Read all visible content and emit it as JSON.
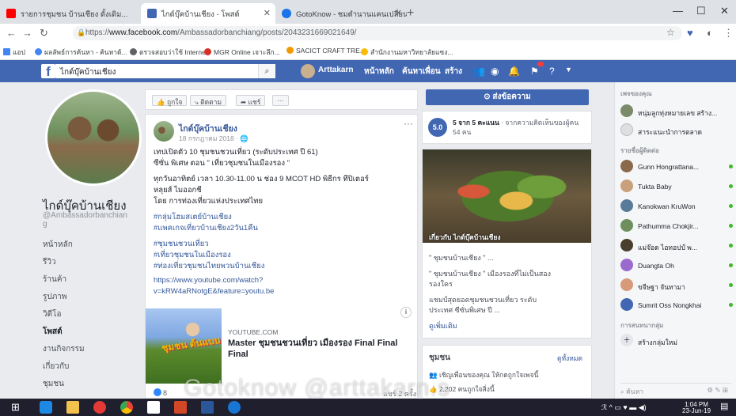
{
  "browser": {
    "tabs": [
      {
        "label": "รายการชุมชน บ้านเชียง ดั้งเดิม...",
        "icon": "youtube-icon",
        "color": "#ff0000"
      },
      {
        "label": "ไกด์บุ๊คบ้านเชียง - โพสต์",
        "icon": "facebook-icon",
        "color": "#4267b2"
      },
      {
        "label": "GotoKnow - ชมตำนานแคนเปลี่ยนไป...",
        "icon": "gotoknow-icon",
        "color": "#1a73e8"
      }
    ],
    "url_prefix": "https://",
    "url_host": "www.facebook.com",
    "url_path": "/Ambassadorbanchiang/posts/2043231669021649/",
    "bookmarks": [
      {
        "label": "แอป",
        "color": "#4285f4"
      },
      {
        "label": "ผลลัพธ์การค้นหา - ค้นหาด้...",
        "color": "#4285f4"
      },
      {
        "label": "ตรวจสอบว่าใช้ Internet",
        "color": "#5f6368"
      },
      {
        "label": "MGR Online เจาะลึก...",
        "color": "#d93025"
      },
      {
        "label": "SACICT CRAFT TRE...",
        "color": "#f29900"
      },
      {
        "label": "สำนักงานมหาวิทยาลัยแซง...",
        "color": "#fbbc04"
      }
    ]
  },
  "fb": {
    "search_value": "ไกด์บุ๊คบ้านเชียง",
    "user_name": "Arttakarn",
    "nav": [
      "หน้าหลัก",
      "ค้นหาเพื่อน",
      "สร้าง"
    ],
    "colors": {
      "brand": "#4267b2",
      "link": "#365899"
    }
  },
  "left": {
    "page_name": "ไกด์บุ๊คบ้านเชียง",
    "page_handle": "@Ambassadorbanchiang",
    "nav": [
      "หน้าหลัก",
      "รีวิว",
      "ร้านค้า",
      "รูปภาพ",
      "วิดีโอ",
      "โพสต์",
      "งานกิจกรรม",
      "เกี่ยวกับ",
      "ชุมชน"
    ],
    "selected_index": 5
  },
  "center": {
    "tab_buttons": [
      "ถูกใจ",
      "ติดตาม",
      "แชร์",
      "···"
    ],
    "post": {
      "author": "ไกด์บุ๊คบ้านเชียง",
      "date": "18 กรกฎาคม 2018 · ",
      "lines": [
        "เทปเปิดตัว 10 ชุมชนชวนเที่ยว (ระดับประเทศ ปี 61)",
        "ซีซั่น พิเศษ ตอน \" เที่ยวชุมชนในเมืองรอง \"",
        "ทุกวันอาทิตย์ เวลา 10.30-11.00 น ช่อง 9 MCOT HD พิธีกร ทีปิเตอร์",
        "หลุยส์ ไมออกชี",
        "โดย การท่องเที่ยวแห่งประเทศไทย"
      ],
      "tags_a": [
        "#กลุ่มโฮมสเตย์บ้านเชียง",
        "#แพคเกจเที่ยวบ้านเชียง2วัน1คืน"
      ],
      "tags_b": [
        "#ชุมชนชวนเที่ยว",
        "#เที่ยวชุมชนในเมืองรอง",
        "#ท่องเที่ยวชุมชนไทยพวนบ้านเชียง"
      ],
      "link_line1": "https://www.youtube.com/watch?",
      "link_line2": "v=kRW4aRNotgE&feature=youtu.be",
      "thumb_text": "ชุมชน ต้นแบบ",
      "link_domain": "YOUTUBE.COM",
      "link_title": "Master ชุมชนชวนเที่ยว เมืองรอง Final Final Final",
      "info_glyph": "i",
      "reactions_count": "8",
      "shares": "แชร์ 2 ครั้ง"
    }
  },
  "right": {
    "message_button": "ส่งข้อความ",
    "rating": {
      "score": "5.0",
      "headline": "5 จาก 5 คะแนน",
      "subtext": "จากความคิดเห็นของผู้คน 54 คน"
    },
    "video": {
      "caption": "เกี่ยวกับ ไกด์บุ๊คบ้านเชียง",
      "lines": [
        "\" ชุมชนบ้านเชียง \" ...",
        "\" ชุมชนบ้านเชียง \" เมืองรองที่ไม่เป็นสอง",
        "รองใคร",
        "แชมป์สุดยอดชุมชนชวนเที่ยว ระดับ",
        "ประเทศ ซีซั่นพิเศษ ปี ..."
      ],
      "see_more": "ดูเพิ่มเติม"
    },
    "community": {
      "title": "ชุมชน",
      "see_all": "ดูทั้งหมด",
      "lines": [
        "เชิญเพื่อนของคุณ ให้กดถูกใจเพจนี้",
        "2,202 คนถูกใจสิ่งนี้"
      ]
    }
  },
  "sidebar": {
    "pages_header": "เพจของคุณ",
    "pages": [
      {
        "label": "หนุ่มลูกทุ่งหมายเลข สร้าง...",
        "color": "#7a8a6a"
      },
      {
        "label": "สาระแนะนำการตลาด",
        "color": "#dddfe2"
      }
    ],
    "contacts_header": "รายชื่อผู้ติดต่อ",
    "contacts": [
      {
        "name": "Gunn Hongrattana...",
        "color": "#8a6a4a"
      },
      {
        "name": "Tukta Baby",
        "color": "#c9a07a"
      },
      {
        "name": "Kanokwan KruWon",
        "color": "#5a7a9a"
      },
      {
        "name": "Pathumma Chokjir...",
        "color": "#6e8f5d"
      },
      {
        "name": "แม่จ๊อด ไอทอปป์ พ...",
        "color": "#4a3f2d"
      },
      {
        "name": "Duangta Oh",
        "color": "#9a6acf"
      },
      {
        "name": "ขจีษฐา จันทามา",
        "color": "#d69a7a"
      },
      {
        "name": "Sumrit Oss Nongkhai",
        "color": "#4267b2"
      }
    ],
    "groups_header": "การสนทนากลุ่ม",
    "create_group": "สร้างกลุ่มใหม่",
    "search_placeholder": "ค้นหา"
  },
  "watermark": "Gotoknow @arttakarn.s",
  "taskbar": {
    "time": "1:04 PM",
    "date": "23-Jun-19"
  }
}
